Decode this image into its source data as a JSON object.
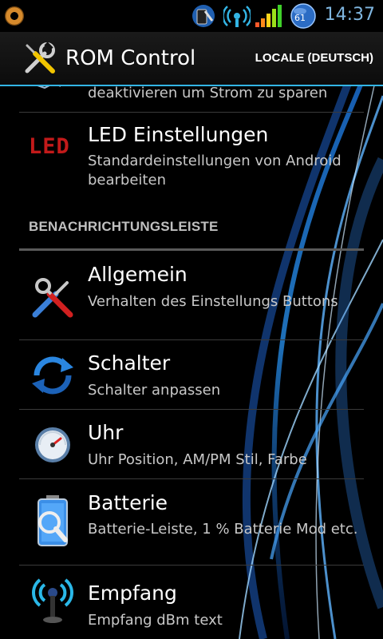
{
  "status_bar": {
    "time": "14:37",
    "battery_level": "61",
    "icons": [
      "app-notification-icon",
      "phone-tool-icon",
      "wifi-hotspot-icon",
      "signal-bars-icon",
      "battery-globe-icon"
    ]
  },
  "action_bar": {
    "icon": "wrench-screwdriver-icon",
    "title": "ROM Control",
    "locale_button": "LOCALE (DEUTSCH)"
  },
  "list": {
    "partial_item": {
      "summary": "deaktivieren um Strom zu sparen"
    },
    "led_item": {
      "icon": "led-icon",
      "icon_text": "LED",
      "title": "LED Einstellungen",
      "summary": "Standardeinstellungen von Android bearbeiten"
    },
    "category": {
      "title": "BENACHRICHTUNGSLEISTE"
    },
    "items": [
      {
        "icon": "tools-icon",
        "title": "Allgemein",
        "summary": "Verhalten des Einstellungs Buttons"
      },
      {
        "icon": "sync-arrows-icon",
        "title": "Schalter",
        "summary": "Schalter anpassen"
      },
      {
        "icon": "clock-gauge-icon",
        "title": "Uhr",
        "summary": "Uhr Position, AM/PM Stil, Farbe"
      },
      {
        "icon": "battery-magnifier-icon",
        "title": "Batterie",
        "summary": "Batterie-Leiste, 1 % Batterie Mod etc."
      },
      {
        "icon": "signal-antenna-icon",
        "title": "Empfang",
        "summary": "Empfang dBm text"
      }
    ]
  },
  "colors": {
    "accent": "#33b5e5",
    "led_red": "#c21a1a",
    "time_blue": "#7fb6e0"
  }
}
